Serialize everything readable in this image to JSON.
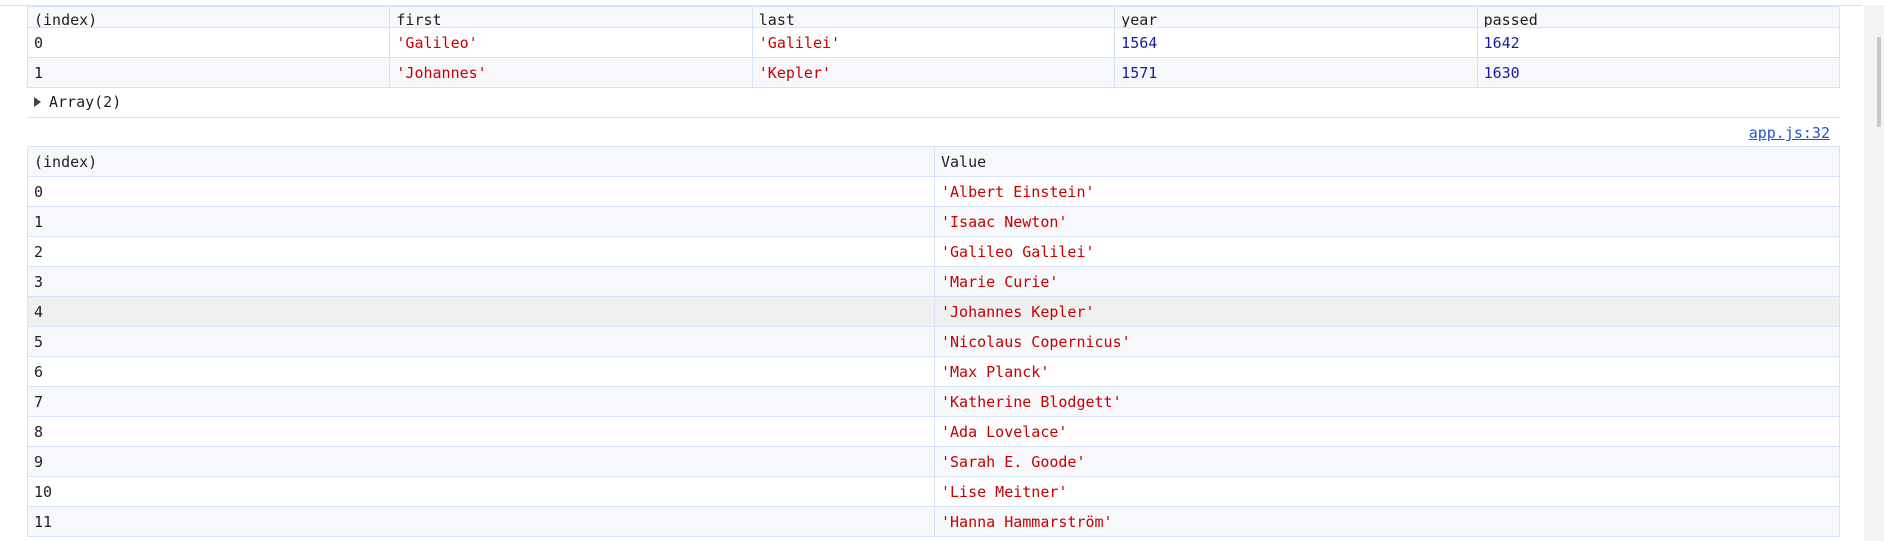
{
  "table1": {
    "headers": [
      "(index)",
      "first",
      "last",
      "year",
      "passed"
    ],
    "rows": [
      {
        "index": "0",
        "first": "'Galileo'",
        "last": "'Galilei'",
        "year": "1564",
        "passed": "1642"
      },
      {
        "index": "1",
        "first": "'Johannes'",
        "last": "'Kepler'",
        "year": "1571",
        "passed": "1630"
      }
    ],
    "summary": "Array(2)"
  },
  "source_link": "app.js:32",
  "table2": {
    "headers": [
      "(index)",
      "Value"
    ],
    "rows": [
      {
        "index": "0",
        "value": "'Albert Einstein'"
      },
      {
        "index": "1",
        "value": "'Isaac Newton'"
      },
      {
        "index": "2",
        "value": "'Galileo Galilei'"
      },
      {
        "index": "3",
        "value": "'Marie Curie'"
      },
      {
        "index": "4",
        "value": "'Johannes Kepler'"
      },
      {
        "index": "5",
        "value": "'Nicolaus Copernicus'"
      },
      {
        "index": "6",
        "value": "'Max Planck'"
      },
      {
        "index": "7",
        "value": "'Katherine Blodgett'"
      },
      {
        "index": "8",
        "value": "'Ada Lovelace'"
      },
      {
        "index": "9",
        "value": "'Sarah E. Goode'"
      },
      {
        "index": "10",
        "value": "'Lise Meitner'"
      },
      {
        "index": "11",
        "value": "'Hanna Hammarström'"
      }
    ]
  },
  "colors": {
    "string": "#c80000",
    "number": "#1a1aa6",
    "link": "#1a56c8",
    "border": "#d6e2f7"
  }
}
